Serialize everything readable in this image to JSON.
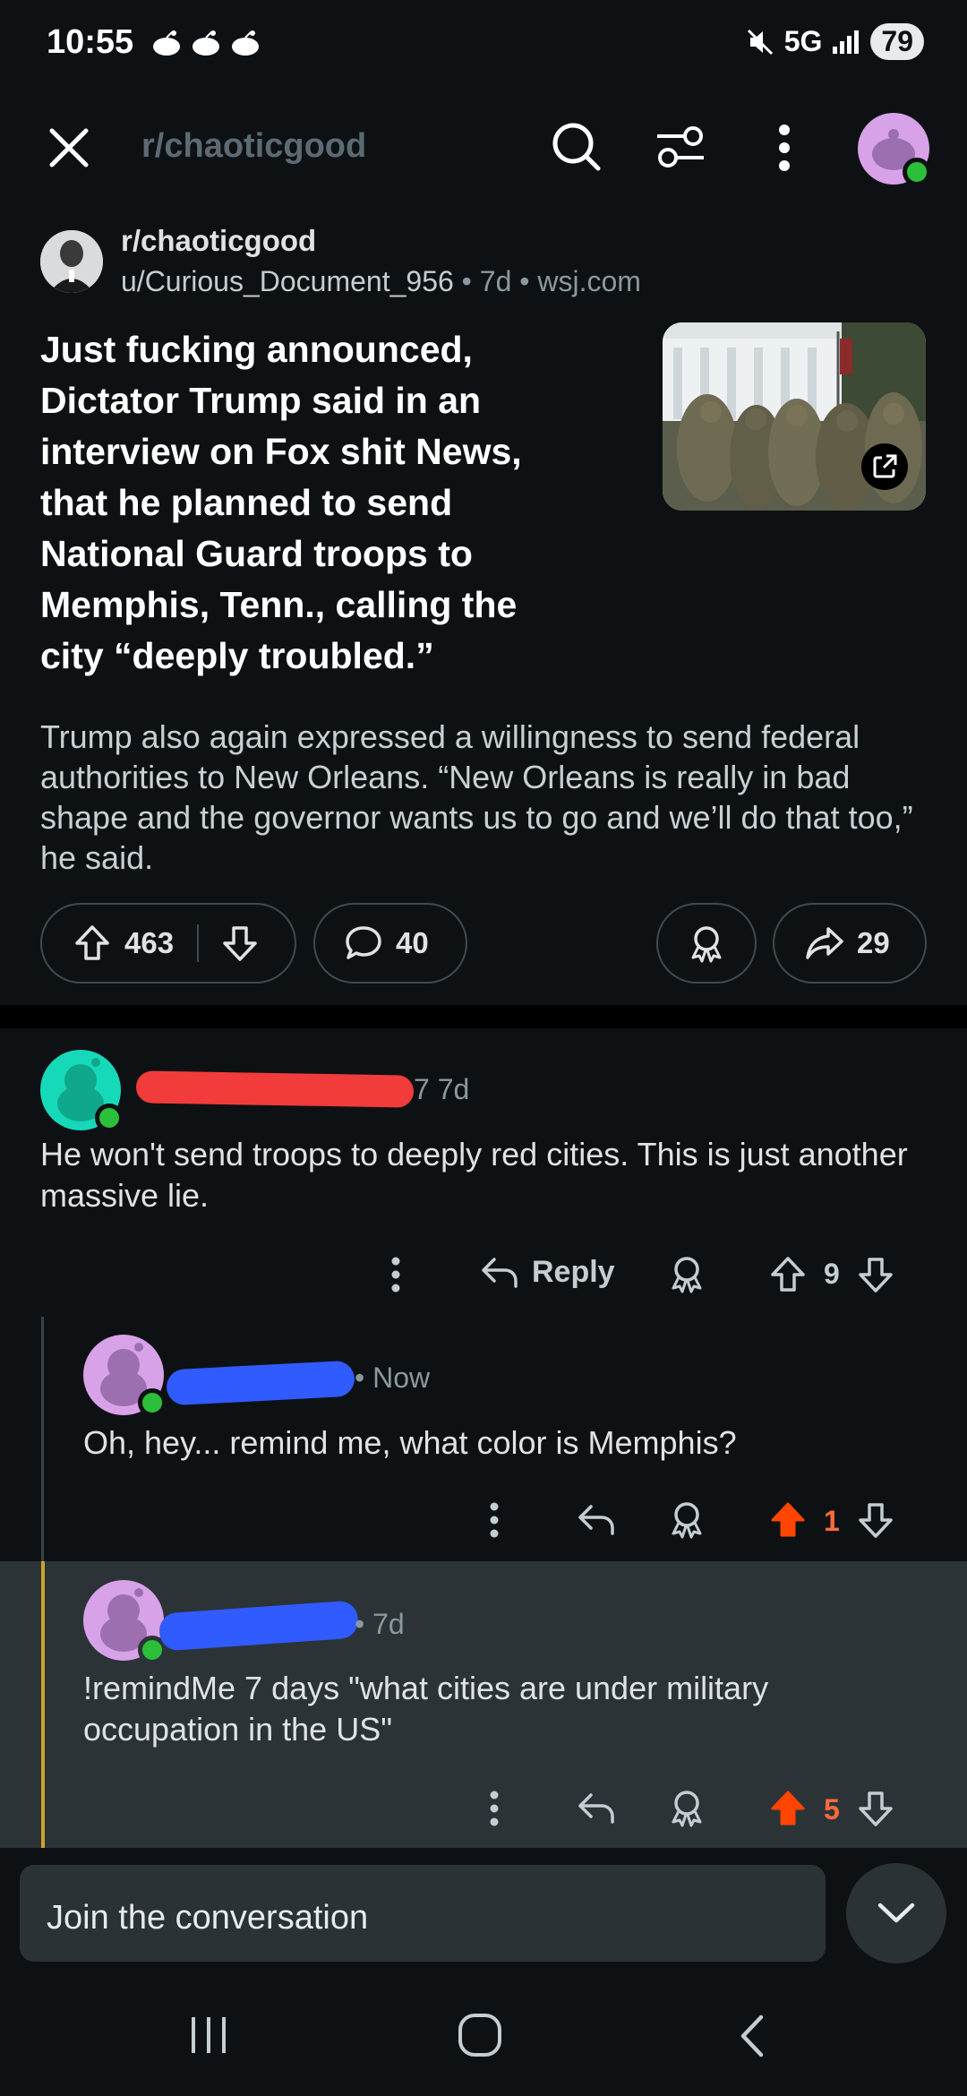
{
  "status_bar": {
    "time": "10:55",
    "network": "5G",
    "battery": "79"
  },
  "top_nav": {
    "subreddit": "r/chaoticgood"
  },
  "post": {
    "subreddit": "r/chaoticgood",
    "author": "u/Curious_Document_956",
    "age": "7d",
    "domain": "wsj.com",
    "title": "Just fucking announced, Dictator Trump said in an interview on Fox shit News, that he planned to send National Guard troops to Memphis, Tenn., calling the city “deeply troubled.”",
    "body": "Trump also again expressed a willingness to send federal authorities to New Orleans. “New Orleans is really in bad shape and the governor wants us to go and we’ll do that too,” he said.",
    "upvotes": "463",
    "comments": "40",
    "shares": "29"
  },
  "comments": [
    {
      "age_label": "7 7d",
      "text": "He won't send troops to deeply red cities. This is just another massive lie.",
      "reply_label": "Reply",
      "score": "9"
    },
    {
      "age_label": "• Now",
      "text": "Oh, hey... remind me, what color is Memphis?",
      "score": "1"
    },
    {
      "age_label": "• 7d",
      "text": "!remindMe 7 days \"what cities are under military occupation in the US\"",
      "score": "5"
    }
  ],
  "composer": {
    "placeholder": "Join the conversation"
  },
  "colors": {
    "background": "#0e1113",
    "upvote_active": "#ff4500",
    "online": "#2bbf3a",
    "highlight": "#2c3337"
  }
}
